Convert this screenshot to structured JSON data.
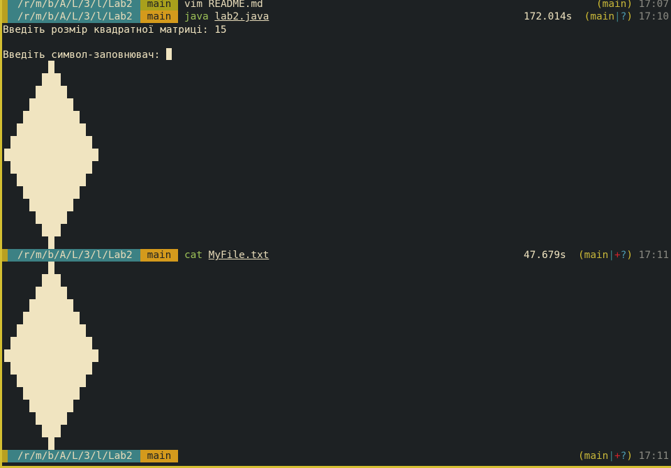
{
  "prompts": [
    {
      "path": "/r/m/b/A/L/3/l/Lab2",
      "branch": "main",
      "command": "vim",
      "argument": "README.md",
      "duration": "",
      "status_open": "(",
      "status_branch": "main",
      "status_close": ")",
      "time": "17:07"
    },
    {
      "path": "/r/m/b/A/L/3/l/Lab2",
      "branch": "main",
      "command": "java",
      "argument": "lab2.java",
      "duration": "172.014s",
      "status_open": "(",
      "status_branch": "main",
      "status_pipe": "|",
      "status_untracked": "?",
      "status_close": ")",
      "time": "17:10"
    },
    {
      "path": "/r/m/b/A/L/3/l/Lab2",
      "branch": "main",
      "command": "cat",
      "argument": "MyFile.txt",
      "duration": "47.679s",
      "status_open": "(",
      "status_branch": "main",
      "status_pipe": "|",
      "status_added": "+",
      "status_untracked": "?",
      "status_close": ")",
      "time": "17:11"
    },
    {
      "path": "/r/m/b/A/L/3/l/Lab2",
      "branch": "main",
      "status_open": "(",
      "status_branch": "main",
      "status_pipe": "|",
      "status_added": "+",
      "status_untracked": "?",
      "status_close": ")",
      "time": "17:11"
    }
  ],
  "output": {
    "matrix_prompt": "Введіть розмір квадратної матриці: 15",
    "symbol_prompt": "Введіть символ-заповнювач: "
  },
  "diamond": {
    "size": 15,
    "half_widths": [
      0,
      1,
      2,
      3,
      4,
      5,
      6,
      7,
      6,
      5,
      4,
      3,
      2,
      1,
      0
    ]
  },
  "colors": {
    "background": "#1d2123",
    "foreground": "#e8dcba",
    "path_segment": "#3c8184",
    "branch_segment": "#d49a1c",
    "command": "#9ec257",
    "added": "#d2232a"
  }
}
